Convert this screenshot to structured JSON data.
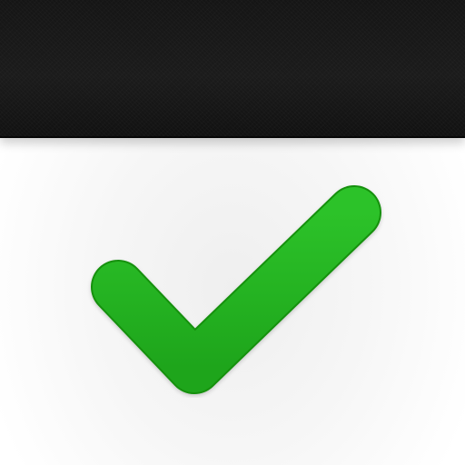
{
  "icon": {
    "name": "checkmark-app-icon",
    "glyph": "check-icon",
    "colors": {
      "header": "#161616",
      "background": "#ffffff",
      "check_fill": "#22b01f",
      "check_stroke": "#13900f"
    }
  }
}
